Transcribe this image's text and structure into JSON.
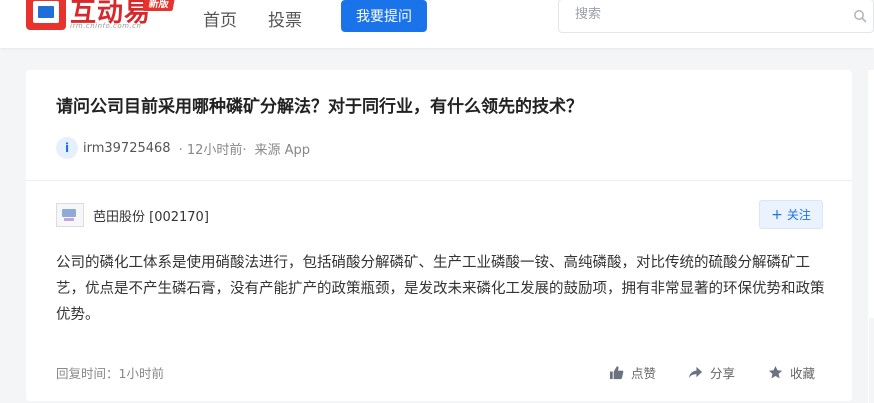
{
  "header": {
    "logo_text": "互动易",
    "logo_badge": "新版",
    "logo_url": "irm.cninfo.com.cn",
    "nav": [
      "首页",
      "投票"
    ],
    "ask_button": "我要提问",
    "search_placeholder": "搜索"
  },
  "question": {
    "title": "请问公司目前采用哪种磷矿分解法？对于同行业，有什么领先的技术？",
    "avatar_letter": "i",
    "asker": "irm39725468",
    "time": "· 12小时前·",
    "source": "来源 App"
  },
  "answer": {
    "company": "芭田股份 [002170]",
    "follow_label": "关注",
    "text": "公司的磷化工体系是使用硝酸法进行，包括硝酸分解磷矿、生产工业磷酸一铵、高纯磷酸，对比传统的硫酸分解磷矿工艺，优点是不产生磷石膏，没有产能扩产的政策瓶颈，是发改未来磷化工发展的鼓励项，拥有非常显著的环保优势和政策优势。",
    "reply_time": "回复时间：1小时前",
    "actions": {
      "like": "点赞",
      "share": "分享",
      "collect": "收藏"
    }
  },
  "colors": {
    "accent": "#1a73e8",
    "brand": "#e8322d"
  }
}
